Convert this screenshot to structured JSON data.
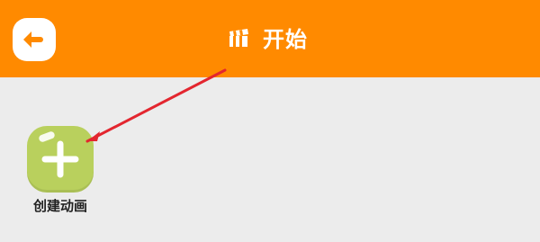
{
  "header": {
    "title": "开始",
    "back_icon": "back-arrow-icon",
    "title_icon": "clapperboard-icon",
    "background_color": "#ff8a00"
  },
  "main": {
    "create_animation": {
      "label": "创建动画",
      "icon": "plus-icon",
      "color": "#b9d05d"
    },
    "background_color": "#ececec"
  },
  "annotation": {
    "color": "#e3262f"
  }
}
